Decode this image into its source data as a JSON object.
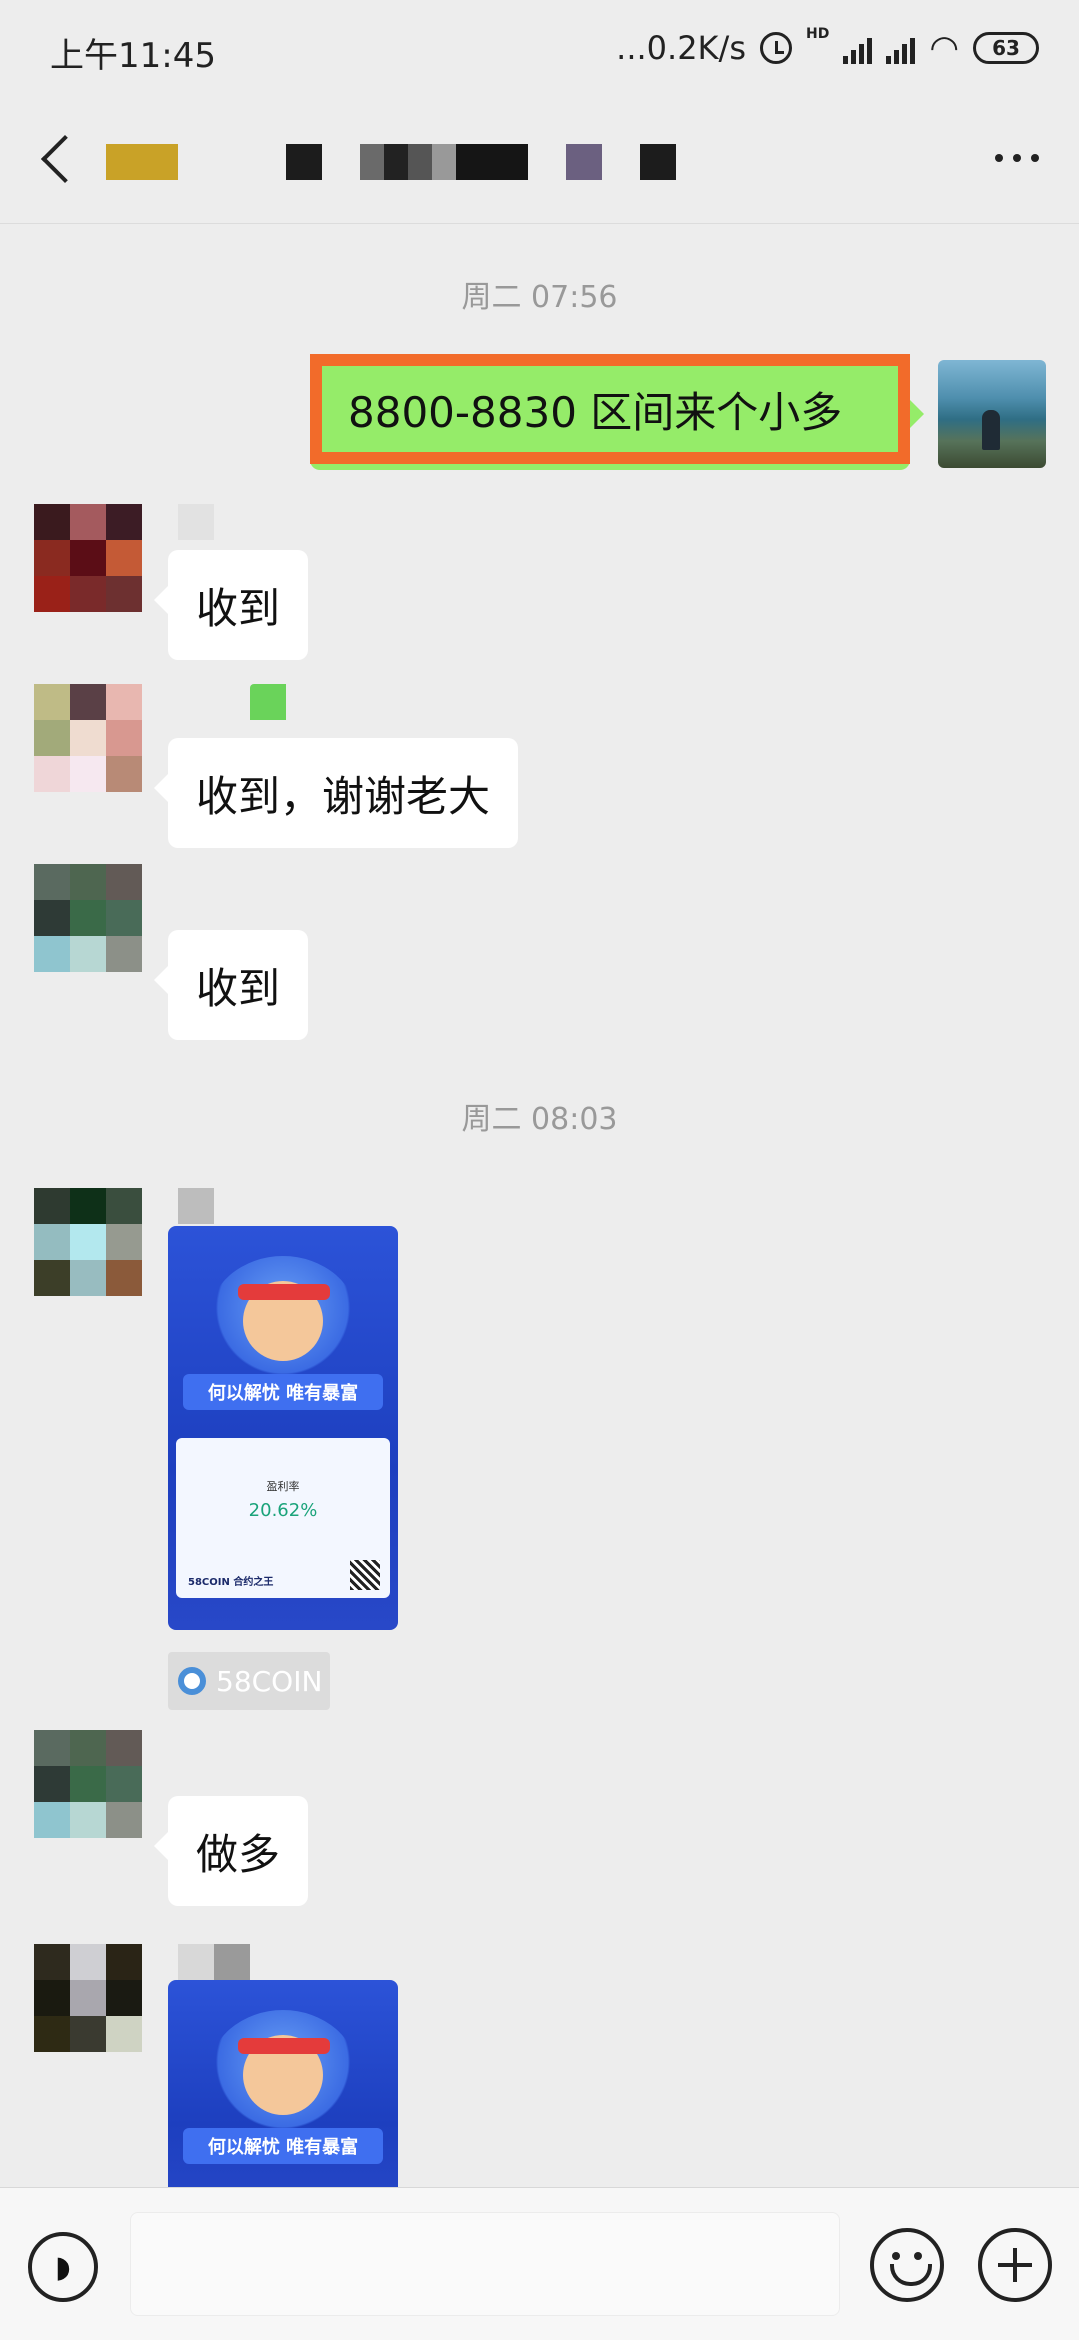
{
  "status_bar": {
    "time": "上午11:45",
    "network_speed": "...0.2K/s",
    "hd_label": "HD",
    "battery": "63"
  },
  "header": {
    "title_icon": "redacted-title",
    "back_icon": "back-arrow-icon",
    "more_icon": "more-dots-icon"
  },
  "chat": {
    "timestamps": [
      "周二 07:56",
      "周二 08:03"
    ],
    "my_message": "8800-8830 区间来个小多",
    "messages": [
      {
        "text": "收到"
      },
      {
        "text": "收到，谢谢老大"
      },
      {
        "text": "收到"
      },
      {
        "text": "做多"
      }
    ],
    "card": {
      "ribbon": "何以解忧 唯有暴富",
      "label": "盈利率",
      "percent": "20.62%",
      "brand": "58COIN",
      "slogan": "合约之王"
    },
    "coin_tag": "58COIN"
  },
  "input_bar": {
    "voice_icon": "voice-icon",
    "emoji_icon": "emoji-icon",
    "plus_icon": "plus-icon",
    "text_value": ""
  },
  "colors": {
    "my_bubble": "#95ec69",
    "highlight_border": "#f26b2a",
    "background": "#ededed"
  }
}
